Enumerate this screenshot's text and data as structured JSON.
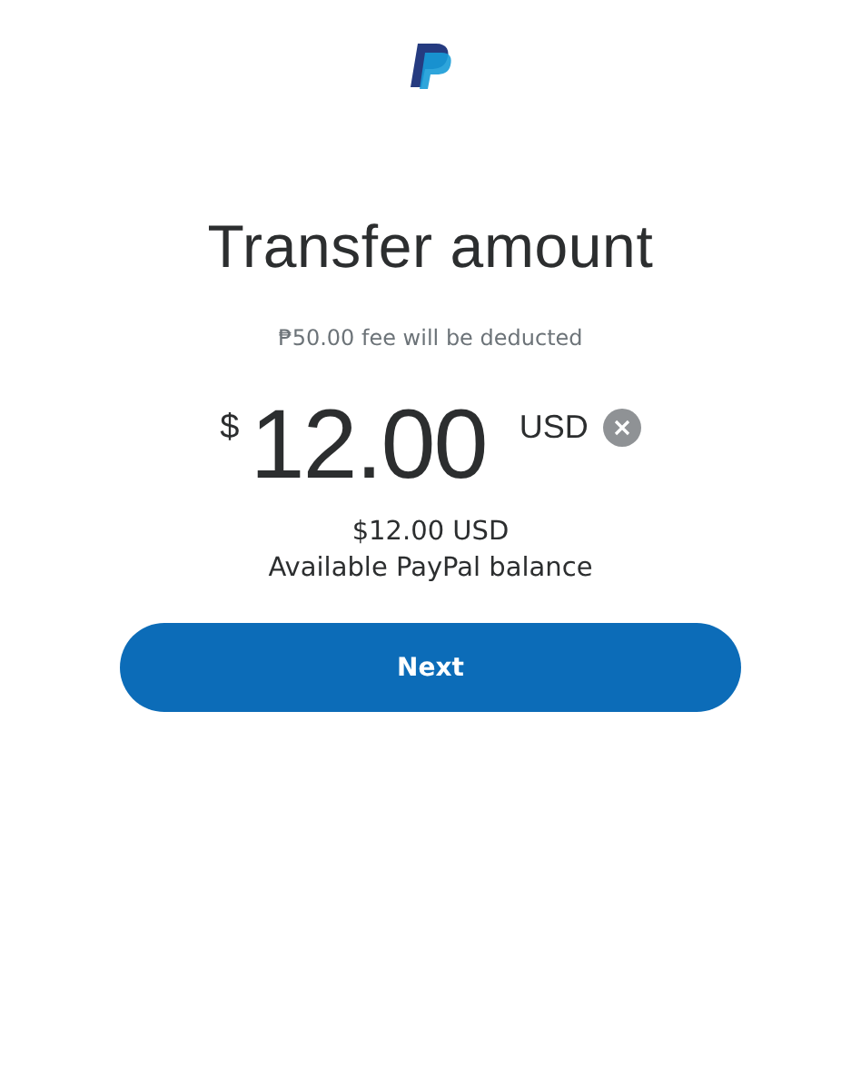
{
  "title": "Transfer amount",
  "fee_note": "₱50.00 fee will be deducted",
  "amount": {
    "currency_symbol": "$",
    "value": "12.00",
    "currency": "USD"
  },
  "balance": {
    "amount": "$12.00 USD",
    "label": "Available PayPal balance"
  },
  "buttons": [
    {
      "label": "Next"
    }
  ]
}
